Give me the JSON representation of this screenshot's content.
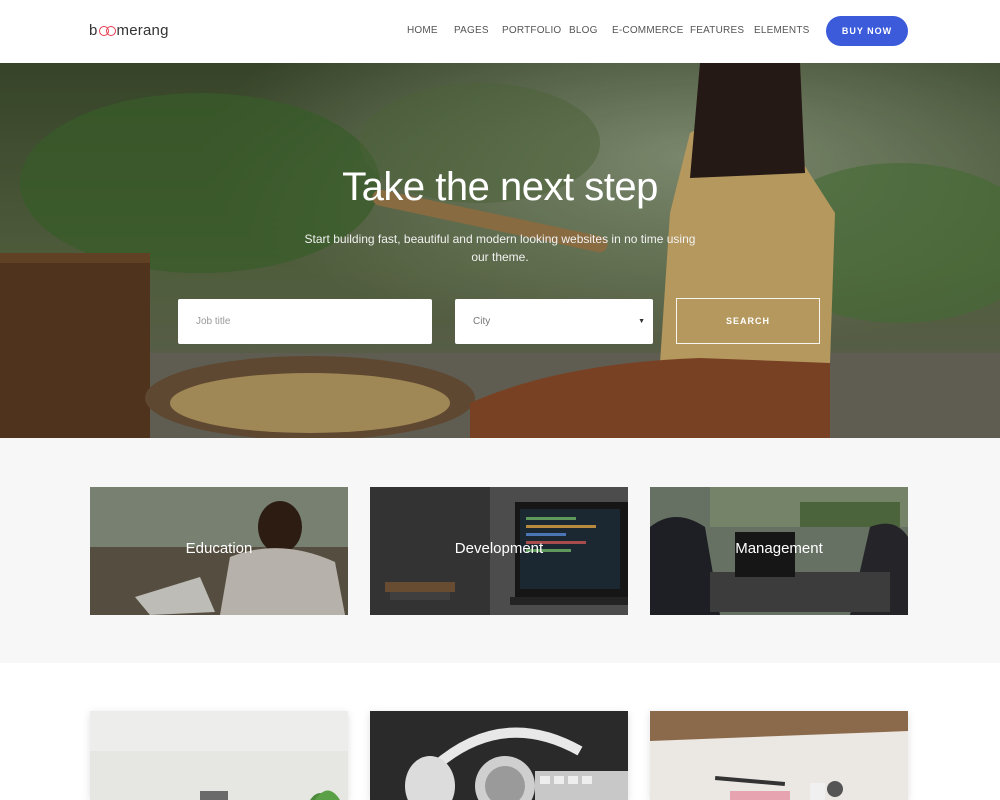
{
  "brand": {
    "logo_text_start": "b",
    "logo_text_end": "merang",
    "accent": "#e63d4f"
  },
  "nav": {
    "items": [
      {
        "label": "HOME"
      },
      {
        "label": "PAGES"
      },
      {
        "label": "PORTFOLIO"
      },
      {
        "label": "BLOG"
      },
      {
        "label": "E-COMMERCE"
      },
      {
        "label": "FEATURES"
      },
      {
        "label": "ELEMENTS"
      }
    ],
    "cta_label": "BUY NOW",
    "cta_color": "#3b5bdb"
  },
  "hero": {
    "title": "Take the next step",
    "subtitle": "Start building fast, beautiful and modern looking websites in no time using our theme.",
    "job_placeholder": "Job title",
    "city_value": "City",
    "search_label": "SEARCH"
  },
  "categories": [
    {
      "label": "Education",
      "image": "man-reading-book"
    },
    {
      "label": "Development",
      "image": "laptop-code"
    },
    {
      "label": "Management",
      "image": "business-meeting"
    }
  ],
  "blog_cards": [
    {
      "image": "desk-plant"
    },
    {
      "image": "headphones-keyboard"
    },
    {
      "image": "desk-notebook"
    }
  ],
  "icons": {
    "city_select": "chevron-down-icon"
  }
}
